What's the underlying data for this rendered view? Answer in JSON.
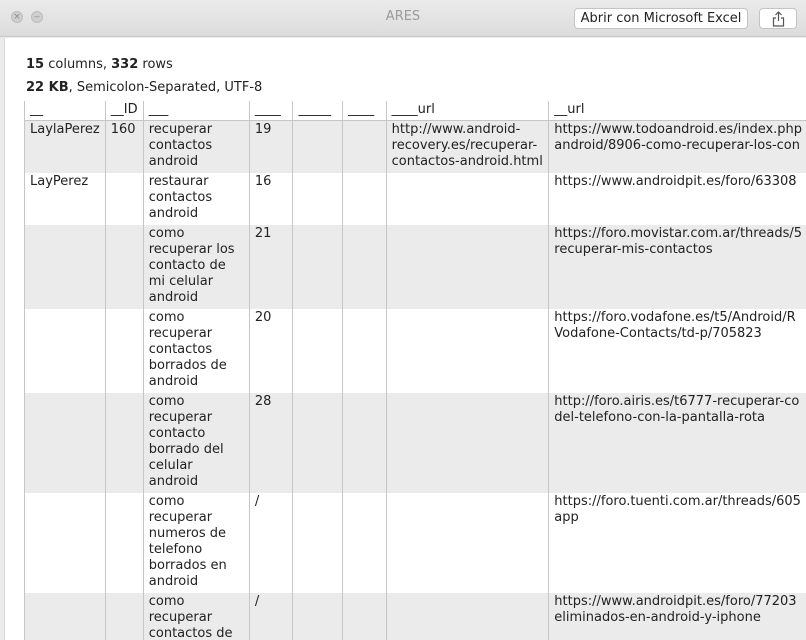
{
  "window": {
    "title": "ARES",
    "open_button": "Abrir con Microsoft Excel"
  },
  "info": {
    "columns_count": "15",
    "columns_label": " columns, ",
    "rows_count": "332",
    "rows_label": " rows",
    "size": "22 KB",
    "format": ", Semicolon-Separated, UTF-8"
  },
  "table": {
    "headers": [
      "__",
      "__ID",
      "___",
      "____",
      "_____",
      "____",
      "____url",
      "__url"
    ],
    "rows": [
      [
        "LaylaPerez",
        "160",
        "recuperar contactos android",
        "19",
        "",
        "",
        "http://www.android-recovery.es/recuperar-contactos-android.html",
        "https://www.todoandroid.es/index.php android/8906-como-recuperar-los-con"
      ],
      [
        "LayPerez",
        "",
        "restaurar contactos android",
        "16",
        "",
        "",
        "",
        "https://www.androidpit.es/foro/63308"
      ],
      [
        "",
        "",
        "como recuperar los contacto de mi celular android",
        "21",
        "",
        "",
        "",
        "https://foro.movistar.com.ar/threads/5 recuperar-mis-contactos"
      ],
      [
        "",
        "",
        "como recuperar contactos borrados de android",
        "20",
        "",
        "",
        "",
        "https://foro.vodafone.es/t5/Android/R Vodafone-Contacts/td-p/705823"
      ],
      [
        "",
        "",
        "como recuperar contacto borrado del celular android",
        "28",
        "",
        "",
        "",
        "http://foro.airis.es/t6777-recuperar-co del-telefono-con-la-pantalla-rota"
      ],
      [
        "",
        "",
        "como recuperar numeros de telefono borrados en android",
        "/",
        "",
        "",
        "",
        "https://foro.tuenti.com.ar/threads/605 app"
      ],
      [
        "",
        "",
        "como recuperar contactos de android",
        "/",
        "",
        "",
        "",
        "https://www.androidpit.es/foro/77203 eliminados-en-android-y-iphone"
      ]
    ]
  }
}
